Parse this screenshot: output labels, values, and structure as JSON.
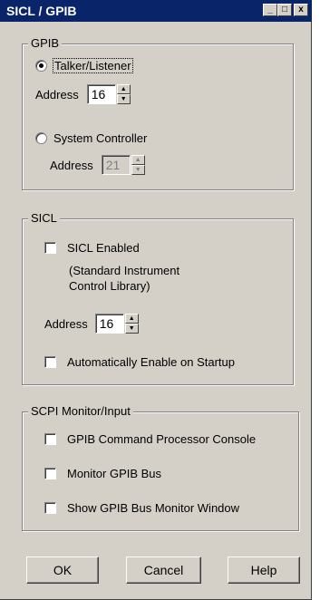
{
  "window": {
    "title": "SICL / GPIB",
    "minimize_glyph": "_",
    "maximize_glyph": "□",
    "close_glyph": "x"
  },
  "gpib": {
    "legend": "GPIB",
    "talker_listener_label": "Talker/Listener",
    "talker_address_label": "Address",
    "talker_address_value": "16",
    "system_controller_label": "System Controller",
    "controller_address_label": "Address",
    "controller_address_value": "21",
    "selected": "talker_listener"
  },
  "sicl": {
    "legend": "SICL",
    "enabled_label": "SICL Enabled",
    "enabled_desc_line1": "(Standard Instrument",
    "enabled_desc_line2": "Control Library)",
    "address_label": "Address",
    "address_value": "16",
    "auto_enable_label": "Automatically Enable on Startup"
  },
  "scpi": {
    "legend": "SCPI Monitor/Input",
    "console_label": "GPIB Command Processor Console",
    "monitor_bus_label": "Monitor GPIB Bus",
    "show_window_label": "Show GPIB Bus Monitor Window"
  },
  "buttons": {
    "ok": "OK",
    "cancel": "Cancel",
    "help": "Help"
  },
  "colors": {
    "titlebar": "#0a246a",
    "face": "#d4d0c8"
  }
}
